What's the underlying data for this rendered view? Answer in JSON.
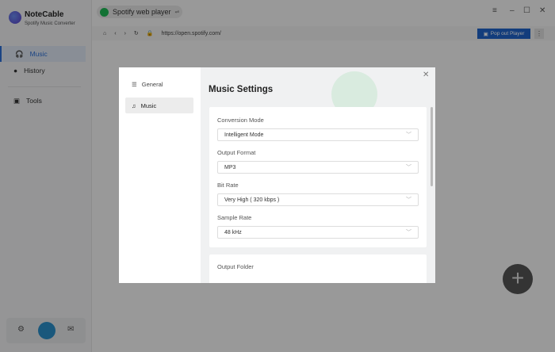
{
  "app": {
    "name": "NoteCable",
    "subtitle": "Spotify Music Converter"
  },
  "sidebar": {
    "items": [
      {
        "label": "Music",
        "icon": "headphones-icon"
      },
      {
        "label": "History",
        "icon": "clock-icon"
      },
      {
        "label": "Tools",
        "icon": "toolbox-icon"
      }
    ]
  },
  "browser": {
    "tab_label": "Spotify web player",
    "tab_icon": "⇌",
    "url": "https://open.spotify.com/",
    "popout_label": "Pop out Player"
  },
  "modal": {
    "nav": [
      {
        "label": "General"
      },
      {
        "label": "Music"
      }
    ],
    "title": "Music Settings",
    "fields": [
      {
        "label": "Conversion Mode",
        "value": "Intelligent Mode"
      },
      {
        "label": "Output Format",
        "value": "MP3"
      },
      {
        "label": "Bit Rate",
        "value": "Very High ( 320 kbps )"
      },
      {
        "label": "Sample Rate",
        "value": "48 kHz"
      }
    ],
    "output_folder_label": "Output Folder"
  }
}
